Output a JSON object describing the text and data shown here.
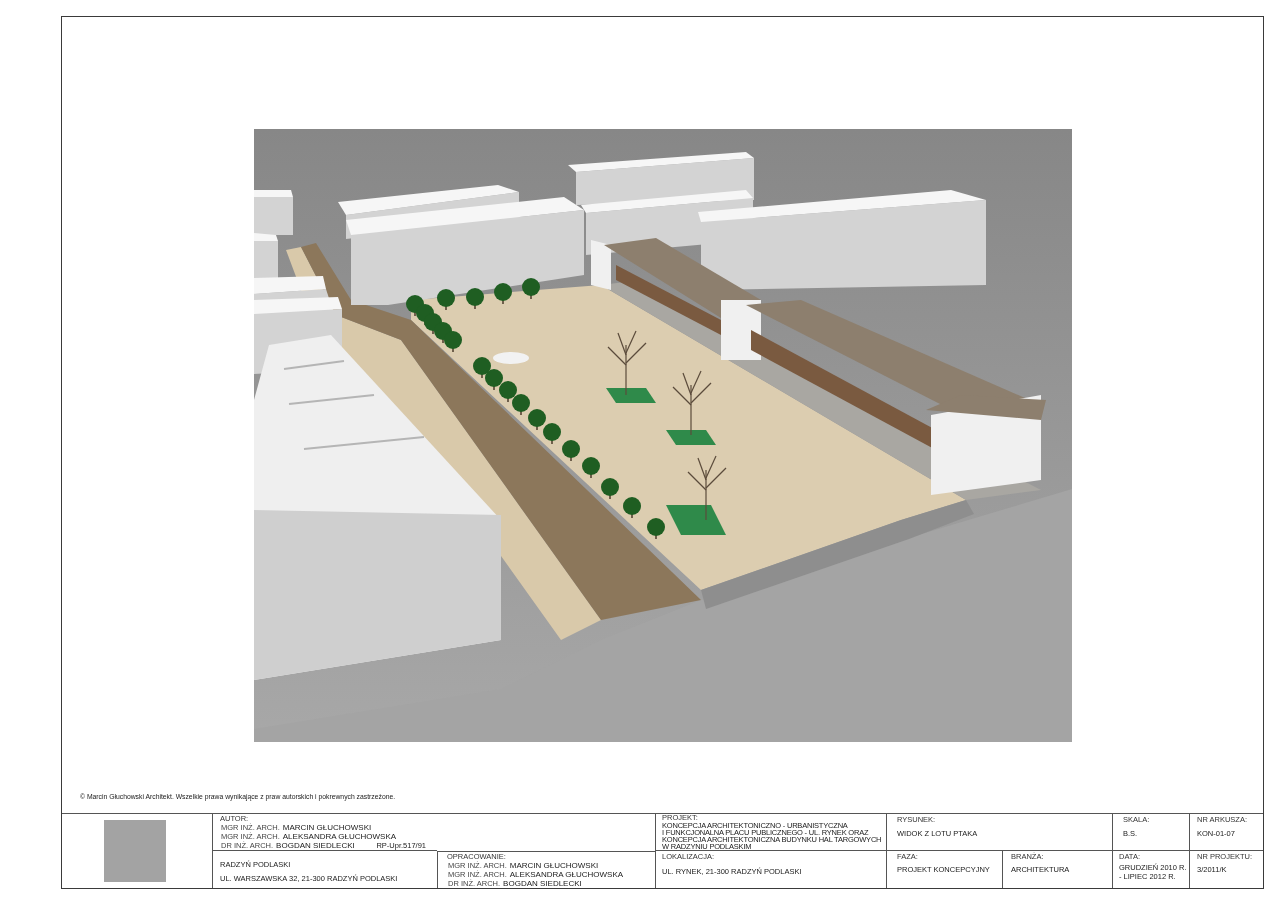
{
  "copyright": "© Marcin Głuchowski Architekt. Wszelkie prawa wynikające z praw autorskich i pokrewnych zastrzeżone.",
  "title_block": {
    "author": {
      "label": "AUTOR:",
      "people": [
        {
          "title": "MGR INŻ. ARCH.",
          "name": "MARCIN GŁUCHOWSKI"
        },
        {
          "title": "MGR INŻ. ARCH.",
          "name": "ALEKSANDRA GŁUCHOWSKA"
        },
        {
          "title": "DR INŻ. ARCH.",
          "name": "BOGDAN SIEDLECKI"
        }
      ],
      "license": "RP-Upr.517/91"
    },
    "investor": {
      "name": "RADZYŃ PODLASKI",
      "address": "UL. WARSZAWSKA 32, 21-300 RADZYŃ PODLASKI"
    },
    "prepared_by": {
      "label": "OPRACOWANIE:",
      "people": [
        {
          "title": "MGR INŻ. ARCH.",
          "name": "MARCIN GŁUCHOWSKI"
        },
        {
          "title": "MGR INŻ. ARCH.",
          "name": "ALEKSANDRA GŁUCHOWSKA"
        },
        {
          "title": "DR INŻ. ARCH.",
          "name": "BOGDAN SIEDLECKI"
        }
      ]
    },
    "project": {
      "label": "PROJEKT:",
      "lines": [
        "KONCEPCJA ARCHITEKTONICZNO - URBANISTYCZNA",
        "I FUNKCJONALNA PLACU PUBLICZNEGO - UL. RYNEK ORAZ",
        "KONCEPCJA ARCHITEKTONICZNA BUDYNKU HAL TARGOWYCH",
        "W RADZYNIU PODLASKIM"
      ]
    },
    "location": {
      "label": "LOKALIZACJA:",
      "value": "UL. RYNEK, 21-300 RADZYŃ PODLASKI"
    },
    "drawing": {
      "label": "RYSUNEK:",
      "value": "WIDOK Z LOTU PTAKA"
    },
    "scale": {
      "label": "SKALA:",
      "value": "B.S."
    },
    "sheet_number": {
      "label": "NR ARKUSZA:",
      "value": "KON-01-07"
    },
    "phase": {
      "label": "FAZA:",
      "value": "PROJEKT KONCEPCYJNY"
    },
    "discipline": {
      "label": "BRANŻA:",
      "value": "ARCHITEKTURA"
    },
    "date": {
      "label": "DATA:",
      "lines": [
        "GRUDZIEŃ 2010 R.",
        "- LIPIEC 2012 R."
      ]
    },
    "project_number": {
      "label": "NR PROJEKTU:",
      "value": "3/2011/K"
    }
  }
}
